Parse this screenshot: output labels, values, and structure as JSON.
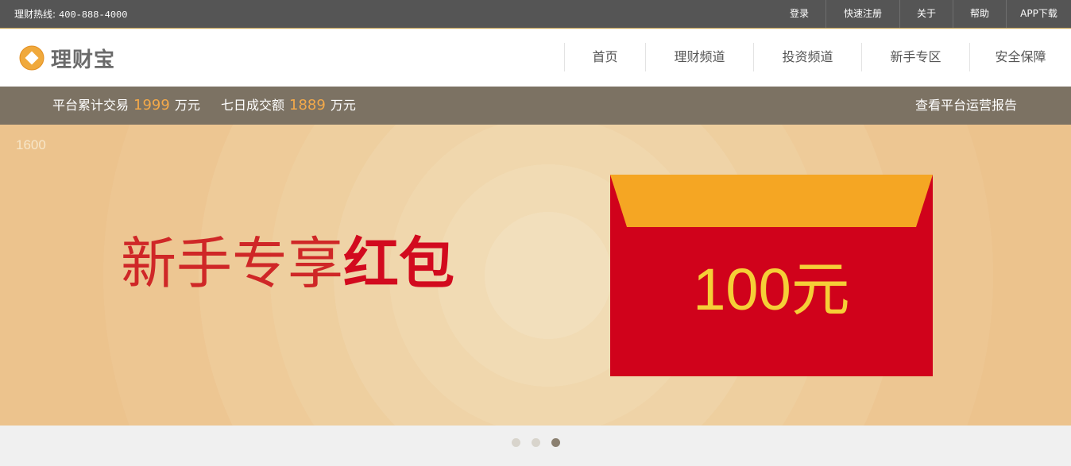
{
  "topbar": {
    "hotline_label": "理财热线:",
    "hotline_number": "400-888-4000",
    "links": [
      "登录",
      "快速注册",
      "关于",
      "帮助",
      "APP下载"
    ]
  },
  "header": {
    "logo_text": "理财宝",
    "nav": [
      "首页",
      "理财频道",
      "投资频道",
      "新手专区",
      "安全保障"
    ]
  },
  "stats": {
    "total_label": "平台累计交易",
    "total_value": "1999",
    "total_unit": "万元",
    "week_label": "七日成交额",
    "week_value": "1889",
    "week_unit": "万元",
    "report_link": "查看平台运营报告"
  },
  "banner": {
    "size_label": "1600",
    "headline_regular": "新手专享",
    "headline_bold": "红包",
    "envelope_amount": "100元"
  },
  "carousel": {
    "slide_count": 3,
    "active_index": 2
  },
  "colors": {
    "topbar": "#555555",
    "stats_bar": "#7c7263",
    "highlight": "#f3a94a",
    "red": "#d0021b",
    "envelope_flap": "#f5a623",
    "amount_yellow": "#f5cf37"
  }
}
